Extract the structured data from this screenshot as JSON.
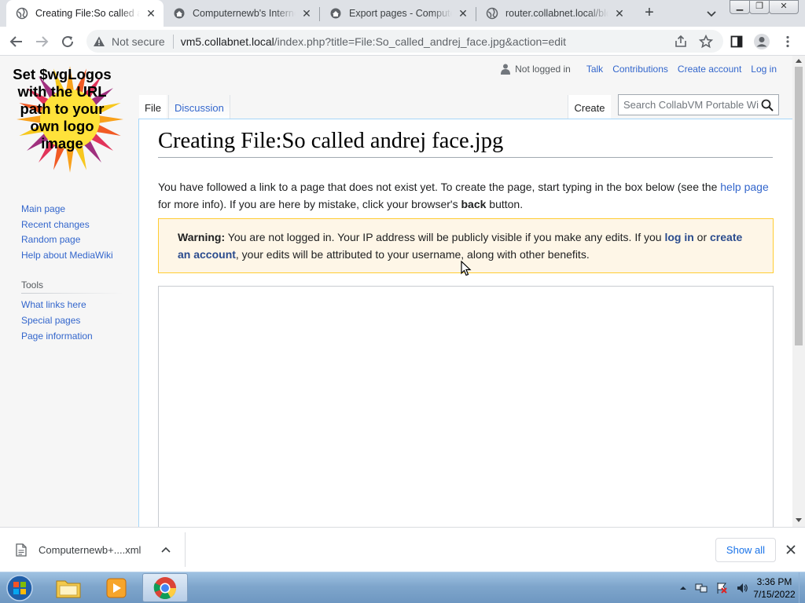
{
  "browser": {
    "tabs": [
      {
        "title": "Creating File:So called andrej face.jpg",
        "active": true
      },
      {
        "title": "Computernewb's Internet Archive",
        "active": false
      },
      {
        "title": "Export pages - Computernewb",
        "active": false
      },
      {
        "title": "router.collabnet.local/blog",
        "active": false
      }
    ],
    "omnibox": {
      "security": "Not secure",
      "host": "vm5.collabnet.local",
      "path": "/index.php?title=File:So_called_andrej_face.jpg&action=edit"
    }
  },
  "wiki": {
    "logo_text": "Set $wgLogos with the URL path to your own logo image",
    "personal": {
      "status": "Not logged in",
      "links": [
        "Talk",
        "Contributions",
        "Create account",
        "Log in"
      ]
    },
    "namespace_tabs": {
      "file": "File",
      "discussion": "Discussion"
    },
    "view_tab": "Create",
    "search_placeholder": "Search CollabVM Portable Wiki",
    "nav_links": [
      "Main page",
      "Recent changes",
      "Random page",
      "Help about MediaWiki"
    ],
    "tools_heading": "Tools",
    "tools_links": [
      "What links here",
      "Special pages",
      "Page information"
    ],
    "heading": "Creating File:So called andrej face.jpg",
    "intro": {
      "part1": "You have followed a link to a page that does not exist yet. To create the page, start typing in the box below (see the ",
      "help_link": "help page",
      "part2": " for more info). If you are here by mistake, click your browser's ",
      "back": "back",
      "part3": " button."
    },
    "warning": {
      "label": "Warning:",
      "part1": " You are not logged in. Your IP address will be publicly visible if you make any edits. If you ",
      "login_link": "log in",
      "part2": " or ",
      "create_link": "create an account",
      "part3": ", your edits will be attributed to your username, along with other benefits."
    }
  },
  "downloads": {
    "file_name": "Computernewb+....xml",
    "show_all": "Show all"
  },
  "taskbar": {
    "time": "3:36 PM",
    "date": "7/15/2022"
  }
}
